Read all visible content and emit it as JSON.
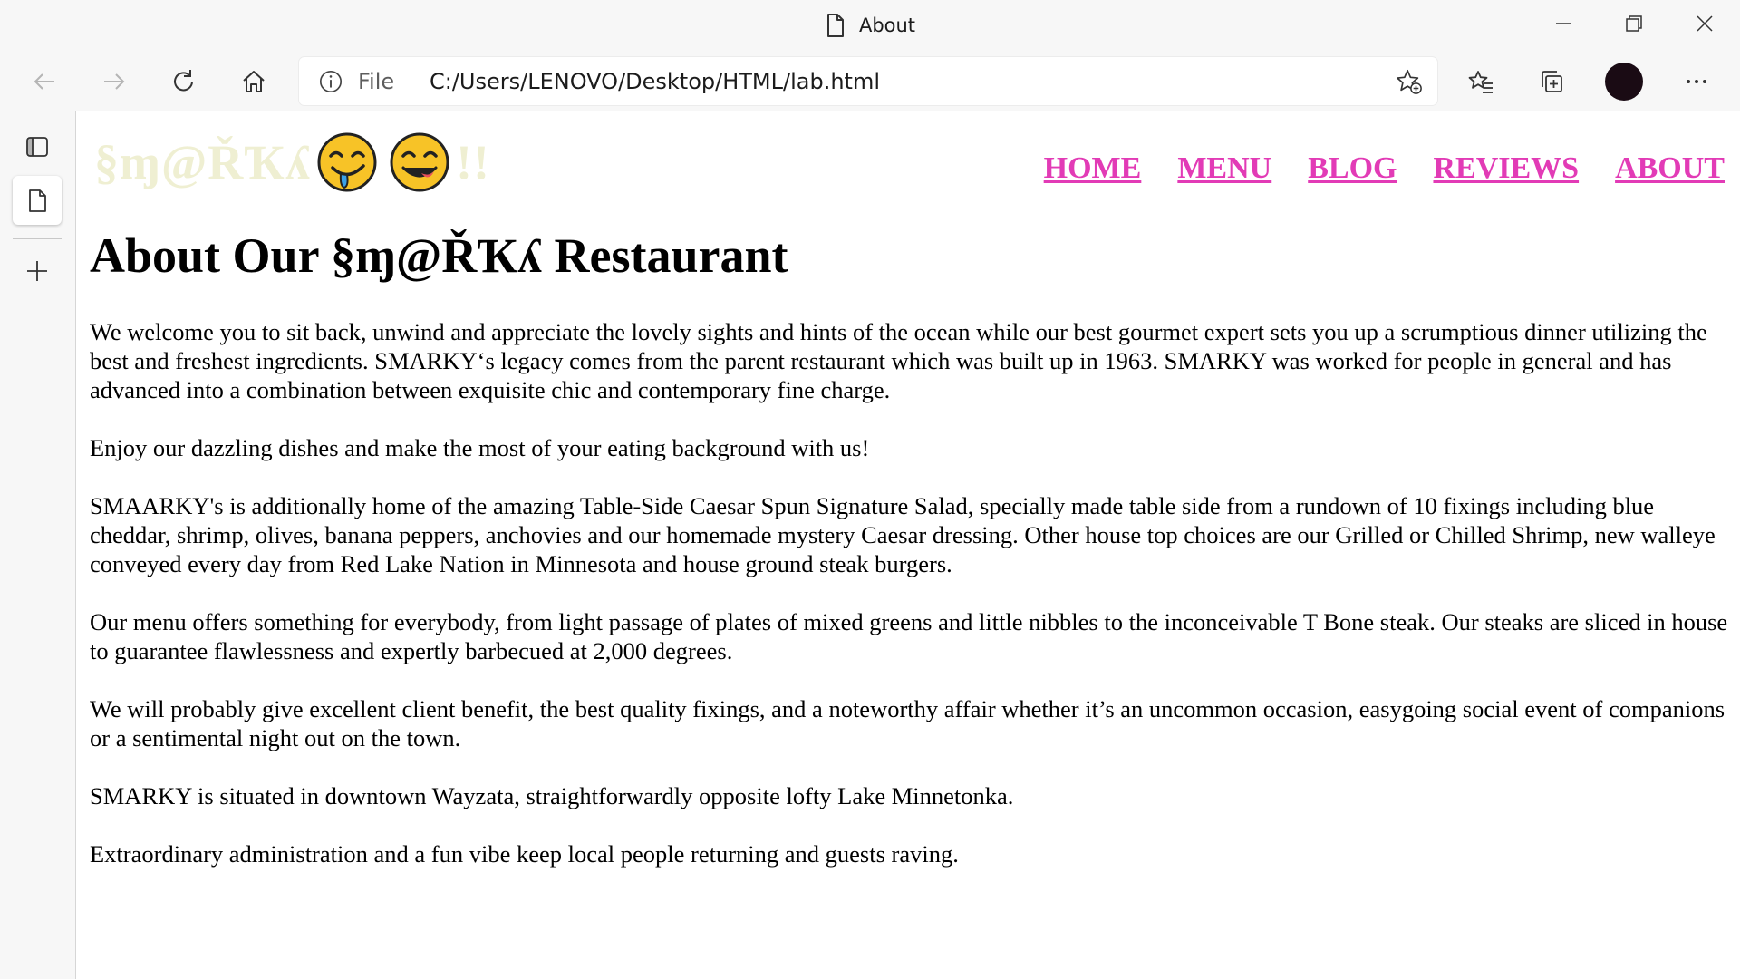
{
  "window": {
    "tab_title": "About"
  },
  "toolbar": {
    "back_icon": "back-arrow-icon",
    "forward_icon": "forward-arrow-icon",
    "refresh_icon": "refresh-icon",
    "home_icon": "home-icon",
    "address": {
      "scheme_label": "File",
      "url": "C:/Users/LENOVO/Desktop/HTML/lab.html"
    },
    "profile_color": "#1a0b14"
  },
  "site": {
    "logo_text": "§ɱ@ŘҠʎ",
    "logo_suffix": "!!",
    "logo_color": "#efefd2",
    "nav_color": "#e23bb6",
    "nav": [
      "HOME",
      "MENU",
      "BLOG",
      "REVIEWS",
      "ABOUT"
    ],
    "heading": "About Our §ɱ@ŘҠʎ Restaurant",
    "paragraphs": [
      "We welcome you to sit back, unwind and appreciate the lovely sights and hints of the ocean while our best gourmet expert sets you up a scrumptious dinner utilizing the best and freshest ingredients. SMARKY‘s legacy comes from the parent restaurant which was built up in 1963. SMARKY was worked for people in general and has advanced into a combination between exquisite chic and contemporary fine charge.",
      "Enjoy our dazzling dishes and make the most of your eating background with us!",
      "SMAARKY's is additionally home of the amazing Table-Side Caesar Spun Signature Salad, specially made table side from a rundown of 10 fixings including blue cheddar, shrimp, olives, banana peppers, anchovies and our homemade mystery Caesar dressing. Other house top choices are our Grilled or Chilled Shrimp, new walleye conveyed every day from Red Lake Nation in Minnesota and house ground steak burgers.",
      "Our menu offers something for everybody, from light passage of plates of mixed greens and little nibbles to the inconceivable T Bone steak. Our steaks are sliced in house to guarantee flawlessness and expertly barbecued at 2,000 degrees.",
      "We will probably give excellent client benefit, the best quality fixings, and a noteworthy affair whether it’s an uncommon occasion, easygoing social event of companions or a sentimental night out on the town.",
      "SMARKY is situated in downtown Wayzata, straightforwardly opposite lofty Lake Minnetonka.",
      "Extraordinary administration and a fun vibe keep local people returning and guests raving."
    ]
  }
}
